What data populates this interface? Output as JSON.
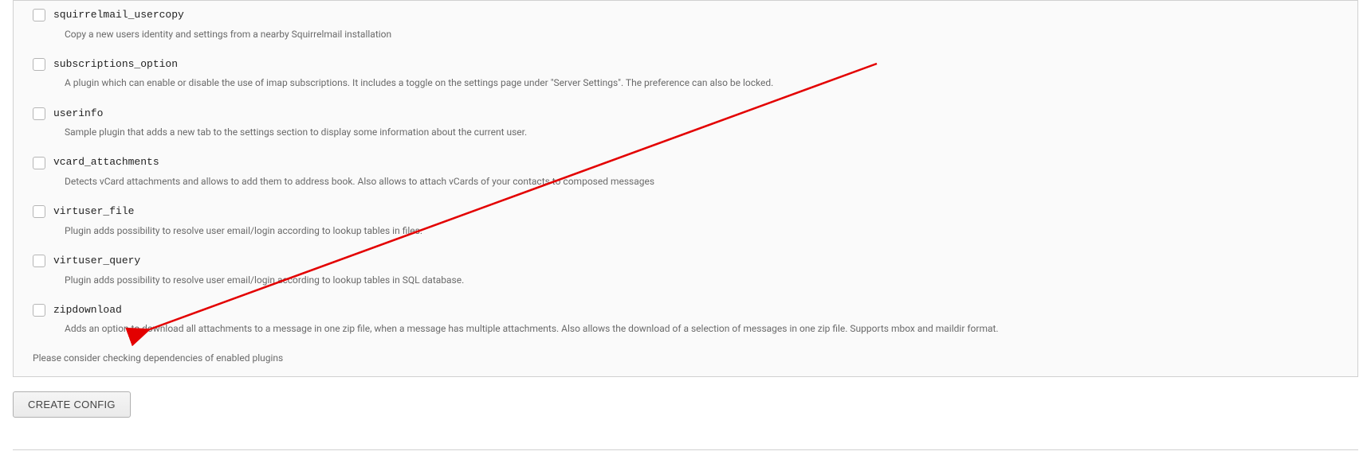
{
  "plugins": [
    {
      "name": "squirrelmail_usercopy",
      "desc": "Copy a new users identity and settings from a nearby Squirrelmail installation"
    },
    {
      "name": "subscriptions_option",
      "desc": "A plugin which can enable or disable the use of imap subscriptions. It includes a toggle on the settings page under \"Server Settings\". The preference can also be locked."
    },
    {
      "name": "userinfo",
      "desc": "Sample plugin that adds a new tab to the settings section to display some information about the current user."
    },
    {
      "name": "vcard_attachments",
      "desc": "Detects vCard attachments and allows to add them to address book. Also allows to attach vCards of your contacts to composed messages"
    },
    {
      "name": "virtuser_file",
      "desc": "Plugin adds possibility to resolve user email/login according to lookup tables in files."
    },
    {
      "name": "virtuser_query",
      "desc": "Plugin adds possibility to resolve user email/login according to lookup tables in SQL database."
    },
    {
      "name": "zipdownload",
      "desc": "Adds an option to download all attachments to a message in one zip file, when a message has multiple attachments. Also allows the download of a selection of messages in one zip file. Supports mbox and maildir format."
    }
  ],
  "footer_note": "Please consider checking dependencies of enabled plugins",
  "button_label": "CREATE CONFIG",
  "bottom_text": ""
}
